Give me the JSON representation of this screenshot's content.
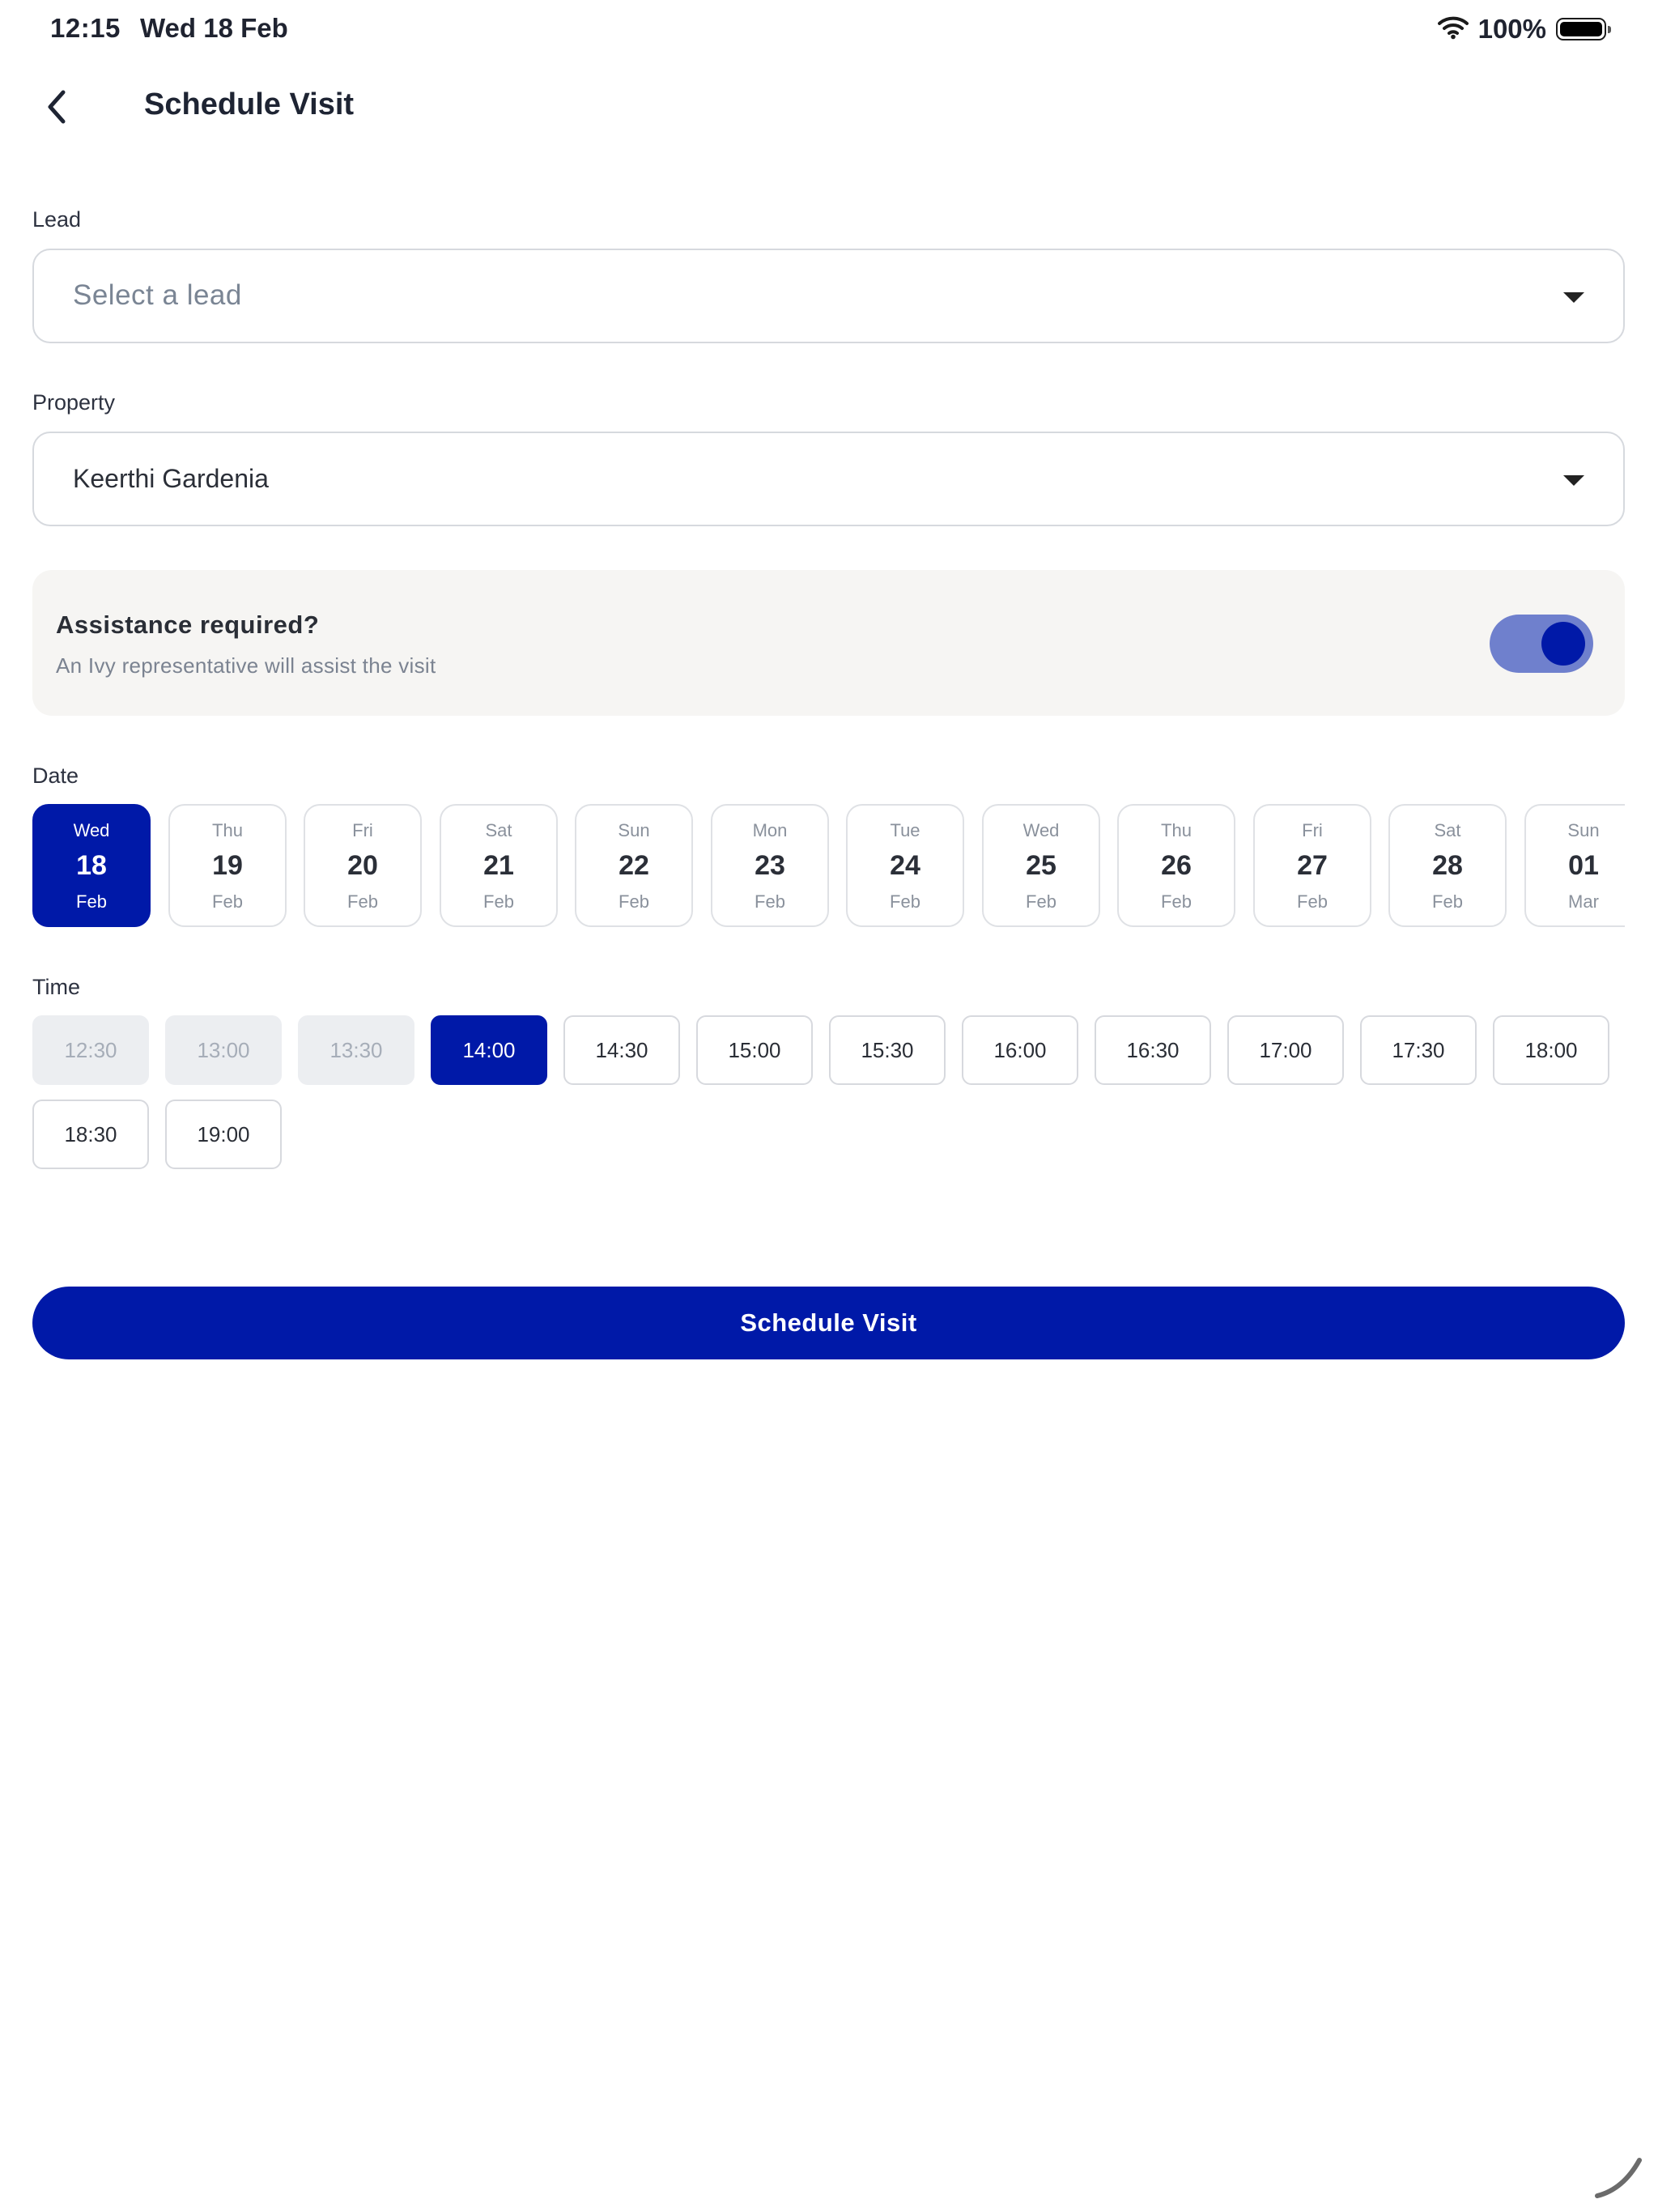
{
  "status_bar": {
    "time": "12:15",
    "date": "Wed 18 Feb",
    "battery_percent": "100%",
    "icons": [
      "wifi-icon",
      "battery-icon"
    ]
  },
  "header": {
    "title": "Schedule Visit",
    "back_icon": "chevron-left-icon"
  },
  "lead": {
    "label": "Lead",
    "placeholder": "Select a lead",
    "value": ""
  },
  "property": {
    "label": "Property",
    "value": "Keerthi Gardenia"
  },
  "assistance": {
    "title": "Assistance required?",
    "subtitle": "An Ivy representative will assist the visit",
    "enabled": true
  },
  "date": {
    "label": "Date",
    "selected_index": 0,
    "options": [
      {
        "dow": "Wed",
        "day": "18",
        "month": "Feb"
      },
      {
        "dow": "Thu",
        "day": "19",
        "month": "Feb"
      },
      {
        "dow": "Fri",
        "day": "20",
        "month": "Feb"
      },
      {
        "dow": "Sat",
        "day": "21",
        "month": "Feb"
      },
      {
        "dow": "Sun",
        "day": "22",
        "month": "Feb"
      },
      {
        "dow": "Mon",
        "day": "23",
        "month": "Feb"
      },
      {
        "dow": "Tue",
        "day": "24",
        "month": "Feb"
      },
      {
        "dow": "Wed",
        "day": "25",
        "month": "Feb"
      },
      {
        "dow": "Thu",
        "day": "26",
        "month": "Feb"
      },
      {
        "dow": "Fri",
        "day": "27",
        "month": "Feb"
      },
      {
        "dow": "Sat",
        "day": "28",
        "month": "Feb"
      },
      {
        "dow": "Sun",
        "day": "01",
        "month": "Mar"
      }
    ]
  },
  "time": {
    "label": "Time",
    "slots": [
      {
        "label": "12:30",
        "state": "disabled"
      },
      {
        "label": "13:00",
        "state": "disabled"
      },
      {
        "label": "13:30",
        "state": "disabled"
      },
      {
        "label": "14:00",
        "state": "selected"
      },
      {
        "label": "14:30",
        "state": "available"
      },
      {
        "label": "15:00",
        "state": "available"
      },
      {
        "label": "15:30",
        "state": "available"
      },
      {
        "label": "16:00",
        "state": "available"
      },
      {
        "label": "16:30",
        "state": "available"
      },
      {
        "label": "17:00",
        "state": "available"
      },
      {
        "label": "17:30",
        "state": "available"
      },
      {
        "label": "18:00",
        "state": "available"
      },
      {
        "label": "18:30",
        "state": "available"
      },
      {
        "label": "19:00",
        "state": "available"
      }
    ]
  },
  "submit": {
    "label": "Schedule Visit"
  },
  "colors": {
    "primary": "#0019a8",
    "toggle_track": "#6f80cd",
    "card_bg": "#f6f5f3",
    "disabled_bg": "#eceef1"
  }
}
